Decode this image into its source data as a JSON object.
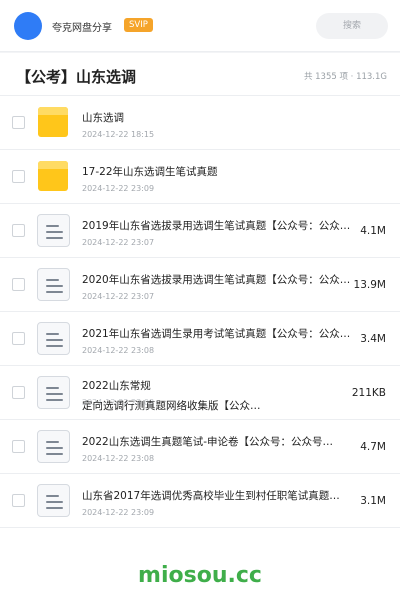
{
  "header": {
    "brand": "夸克网盘分享",
    "badge": "SVIP",
    "search_placeholder": "搜索"
  },
  "folder": {
    "title": "【公考】山东选调",
    "stats": "共 1355 项 · 113.1G"
  },
  "files": [
    {
      "type": "folder",
      "name": "山东选调",
      "date": "2024-12-22 18:15",
      "size": ""
    },
    {
      "type": "folder",
      "name": "17-22年山东选调生笔试真题",
      "date": "2024-12-22 23:09",
      "size": ""
    },
    {
      "type": "doc",
      "name": "2019年山东省选拔录用选调生笔试真题【公众号：公众号…",
      "date": "2024-12-22 23:07",
      "size": "4.1M"
    },
    {
      "type": "doc",
      "name": "2020年山东省选拔录用选调生笔试真题【公众号：公众号…",
      "date": "2024-12-22 23:07",
      "size": "13.9M"
    },
    {
      "type": "doc",
      "name": "2021年山东省选调生录用考试笔试真题【公众号：公众号…",
      "date": "2024-12-22 23:08",
      "size": "3.4M"
    },
    {
      "type": "doc",
      "name": "2022山东常规",
      "name2": "定向选调行测真题网络收集版【公众…",
      "date": "2024-12-22 23:08",
      "size": "211KB"
    },
    {
      "type": "doc",
      "name": "2022山东选调生真题笔试-申论卷【公众号：公众号…",
      "date": "2024-12-22 23:08",
      "size": "4.7M"
    },
    {
      "type": "doc",
      "name": "山东省2017年选调优秀高校毕业生到村任职笔试真题…",
      "date": "2024-12-22 23:09",
      "size": "3.1M"
    }
  ],
  "watermark": "miosou.cc"
}
